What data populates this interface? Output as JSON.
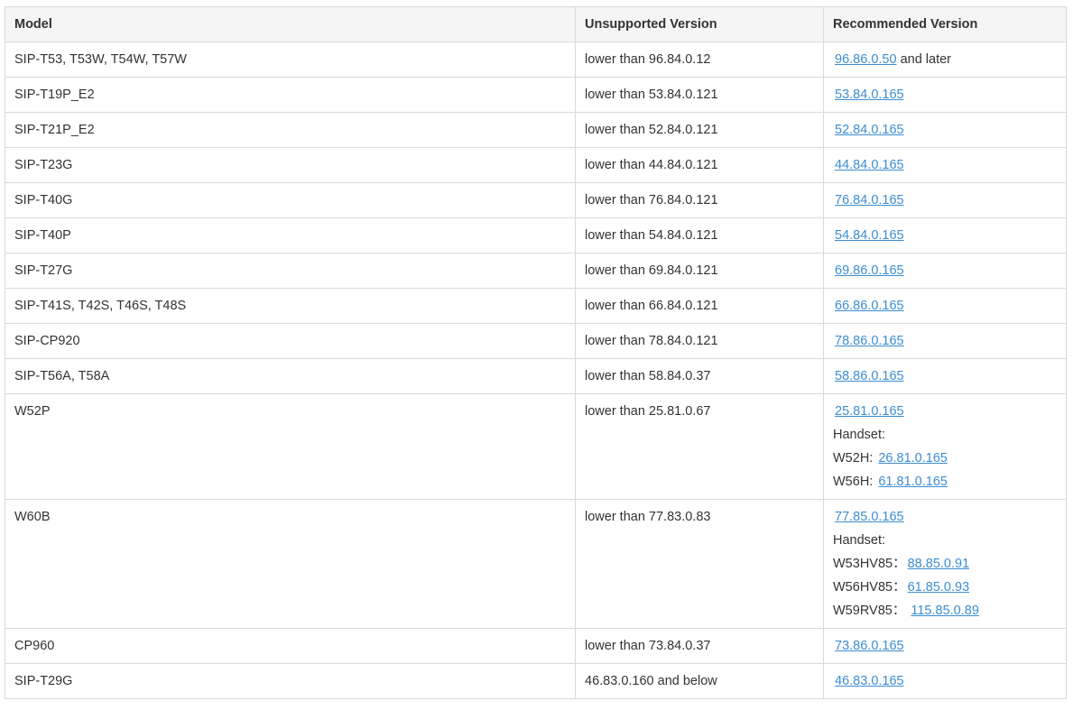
{
  "columns": {
    "model": "Model",
    "unsupported": "Unsupported Version",
    "recommended": "Recommended Version"
  },
  "rows": [
    {
      "model": "SIP-T53, T53W, T54W, T57W",
      "unsupported": "lower than 96.84.0.12",
      "recommended": "96.86.0.50",
      "suffix": " and later"
    },
    {
      "model": "SIP-T19P_E2",
      "unsupported": "lower than 53.84.0.121",
      "recommended": "53.84.0.165"
    },
    {
      "model": "SIP-T21P_E2",
      "unsupported": "lower than 52.84.0.121",
      "recommended": "52.84.0.165"
    },
    {
      "model": "SIP-T23G",
      "unsupported": "lower than 44.84.0.121",
      "recommended": "44.84.0.165"
    },
    {
      "model": "SIP-T40G",
      "unsupported": "lower than 76.84.0.121",
      "recommended": "76.84.0.165"
    },
    {
      "model": "SIP-T40P",
      "unsupported": "lower than 54.84.0.121",
      "recommended": "54.84.0.165"
    },
    {
      "model": "SIP-T27G",
      "unsupported": "lower than 69.84.0.121",
      "recommended": "69.86.0.165"
    },
    {
      "model": "SIP-T41S, T42S, T46S, T48S",
      "unsupported": "lower than 66.84.0.121",
      "recommended": "66.86.0.165"
    },
    {
      "model": "SIP-CP920",
      "unsupported": "lower than 78.84.0.121",
      "recommended": "78.86.0.165"
    },
    {
      "model": "SIP-T56A, T58A",
      "unsupported": "lower than 58.84.0.37",
      "recommended": "58.86.0.165"
    },
    {
      "model": "W52P",
      "unsupported": "lower than 25.81.0.67",
      "recommended": "25.81.0.165",
      "handset_label": "Handset:",
      "handsets": [
        {
          "name": "W52H:",
          "version": "26.81.0.165"
        },
        {
          "name": "W56H:",
          "version": "61.81.0.165"
        }
      ]
    },
    {
      "model": "W60B",
      "unsupported": "lower than 77.83.0.83",
      "recommended": "77.85.0.165",
      "handset_label": "Handset:",
      "handsets": [
        {
          "name": "W53HV85：",
          "version": "88.85.0.91"
        },
        {
          "name": "W56HV85：",
          "version": "61.85.0.93"
        },
        {
          "name": "W59RV85：",
          "version": "115.85.0.89"
        }
      ]
    },
    {
      "model": "CP960",
      "unsupported": "lower than 73.84.0.37",
      "recommended": "73.86.0.165"
    },
    {
      "model": "SIP-T29G",
      "unsupported": "46.83.0.160 and below",
      "recommended": "46.83.0.165"
    }
  ]
}
